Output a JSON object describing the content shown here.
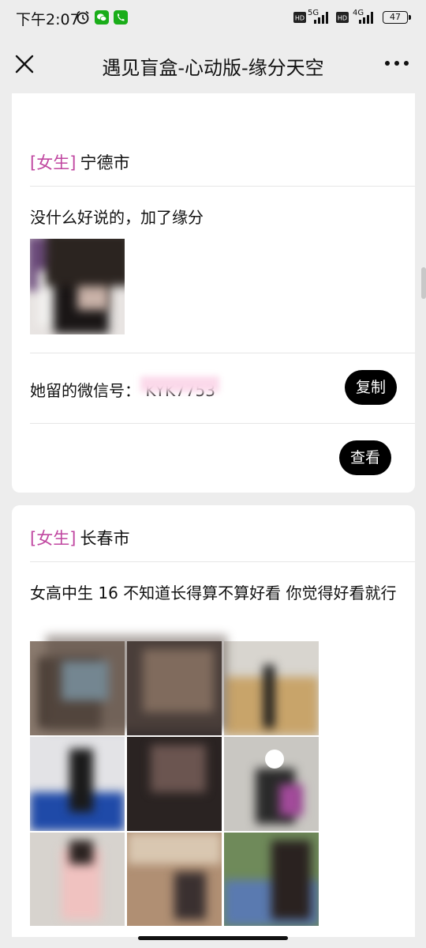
{
  "status_bar": {
    "time": "下午2:07",
    "net_1": "5G",
    "net_2": "4G",
    "battery": "47"
  },
  "nav": {
    "title": "遇见盲盒-心动版-缘分天空"
  },
  "cards": [
    {
      "gender": "[女生]",
      "city": "宁德市",
      "description": "没什么好说的，加了缘分",
      "wechat_label": "她留的微信号：",
      "wechat_value": "KYK7753",
      "copy_label": "复制",
      "view_label": "查看"
    },
    {
      "gender": "[女生]",
      "city": "长春市",
      "description": "女高中生 16 不知道长得算不算好看 你觉得好看就行"
    }
  ],
  "colors": {
    "accent_pink": "#c046a0",
    "button_black": "#000000",
    "background": "#ededed"
  }
}
